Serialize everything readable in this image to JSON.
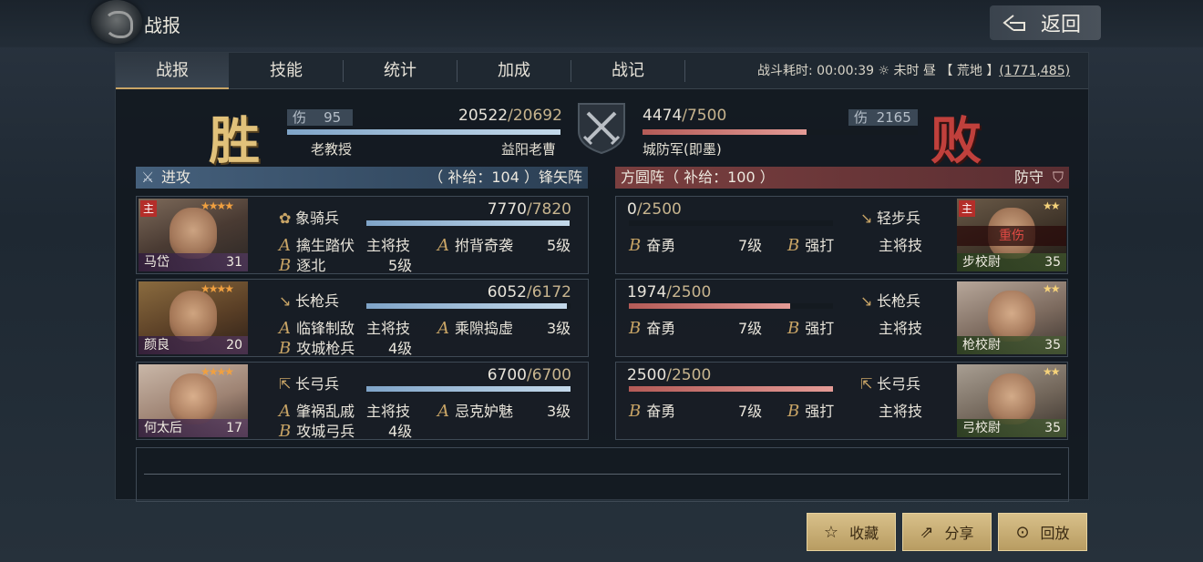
{
  "header": {
    "title": "战报",
    "back_label": "返回"
  },
  "tabs": [
    {
      "label": "战报",
      "active": true
    },
    {
      "label": "技能"
    },
    {
      "label": "统计"
    },
    {
      "label": "加成"
    },
    {
      "label": "战记"
    }
  ],
  "battle_info": {
    "duration_label": "战斗耗时:",
    "duration": "00:00:39",
    "weather": "未时 昼",
    "terrain": "【 荒地 】",
    "coords": "(1771,485)"
  },
  "result": {
    "win_char": "胜",
    "lose_char": "败"
  },
  "attacker": {
    "damage_label": "伤",
    "damage": "95",
    "troops": "20522",
    "troops_max": "/20692",
    "troops_fraction": 0.992,
    "player": "老教授",
    "city": "益阳老曹",
    "header": "进攻",
    "supply": "（ 补给：104 ）锋矢阵"
  },
  "defender": {
    "damage_label": "伤",
    "damage": "2165",
    "troops": "4474",
    "troops_max": "/7500",
    "troops_fraction": 0.597,
    "name": "城防军(即墨)",
    "header": "方圆阵（ 补给：100 ）",
    "stance": "防守"
  },
  "attacker_units": [
    {
      "name": "马岱",
      "level": "31",
      "main": "主",
      "stars": "★★★★",
      "troop_type": "象骑兵",
      "troop_icon": "✿",
      "troops": "7770",
      "troops_max": "/7820",
      "fraction": 0.994,
      "skills": [
        {
          "grade": "A",
          "name": "擒生踏伏",
          "tag": "主将技"
        },
        {
          "grade": "A",
          "name": "拊背奇袭",
          "tag": "5级"
        },
        {
          "grade": "B",
          "name": "逐北",
          "tag": "5级"
        }
      ]
    },
    {
      "name": "颜良",
      "level": "20",
      "stars": "★★★★",
      "troop_type": "长枪兵",
      "troop_icon": "↘",
      "troops": "6052",
      "troops_max": "/6172",
      "fraction": 0.981,
      "skills": [
        {
          "grade": "A",
          "name": "临锋制敌",
          "tag": "主将技"
        },
        {
          "grade": "A",
          "name": "乘隙捣虚",
          "tag": "3级"
        },
        {
          "grade": "B",
          "name": "攻城枪兵",
          "tag": "4级"
        }
      ]
    },
    {
      "name": "何太后",
      "level": "17",
      "stars": "★★★★",
      "troop_type": "长弓兵",
      "troop_icon": "⇱",
      "troops": "6700",
      "troops_max": "/6700",
      "fraction": 1.0,
      "skills": [
        {
          "grade": "A",
          "name": "肇祸乱戚",
          "tag": "主将技"
        },
        {
          "grade": "A",
          "name": "忌克妒魅",
          "tag": "3级"
        },
        {
          "grade": "B",
          "name": "攻城弓兵",
          "tag": "4级"
        }
      ]
    }
  ],
  "defender_units": [
    {
      "name": "步校尉",
      "level": "35",
      "main": "主",
      "stars": "★★",
      "status": "重伤",
      "troop_type": "轻步兵",
      "troop_icon": "↘",
      "troops": "0",
      "troops_max": "/2500",
      "fraction": 0.0,
      "skills": [
        {
          "grade": "B",
          "name": "奋勇",
          "tag": "7级"
        },
        {
          "grade": "B",
          "name": "强打",
          "tag": "主将技"
        }
      ]
    },
    {
      "name": "枪校尉",
      "level": "35",
      "stars": "★★",
      "troop_type": "长枪兵",
      "troop_icon": "↘",
      "troops": "1974",
      "troops_max": "/2500",
      "fraction": 0.79,
      "skills": [
        {
          "grade": "B",
          "name": "奋勇",
          "tag": "7级"
        },
        {
          "grade": "B",
          "name": "强打",
          "tag": "主将技"
        }
      ]
    },
    {
      "name": "弓校尉",
      "level": "35",
      "stars": "★★",
      "troop_type": "长弓兵",
      "troop_icon": "⇱",
      "troops": "2500",
      "troops_max": "/2500",
      "fraction": 1.0,
      "skills": [
        {
          "grade": "B",
          "name": "奋勇",
          "tag": "7级"
        },
        {
          "grade": "B",
          "name": "强打",
          "tag": "主将技"
        }
      ]
    }
  ],
  "actions": {
    "favorite": "收藏",
    "share": "分享",
    "replay": "回放"
  }
}
